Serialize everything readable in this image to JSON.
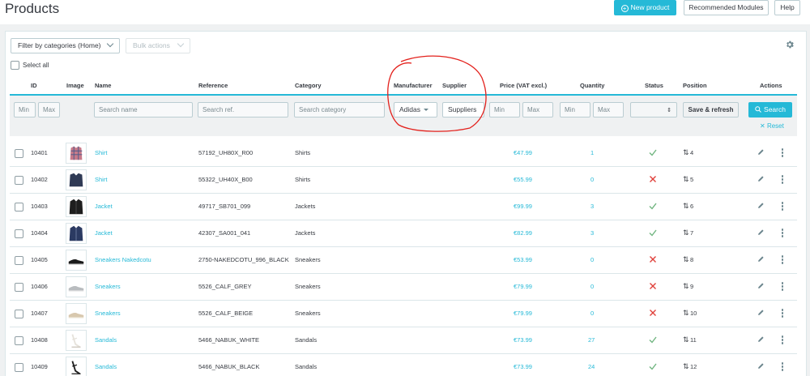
{
  "header": {
    "title": "Products",
    "new_product": "New product",
    "recommended": "Recommended Modules",
    "help": "Help"
  },
  "toolbar": {
    "filter_categories": "Filter by categories (Home)",
    "bulk_actions": "Bulk actions",
    "select_all": "Select all"
  },
  "columns": {
    "id": "ID",
    "image": "Image",
    "name": "Name",
    "reference": "Reference",
    "category": "Category",
    "manufacturer": "Manufacturer",
    "supplier": "Supplier",
    "price": "Price (VAT excl.)",
    "quantity": "Quantity",
    "status": "Status",
    "position": "Position",
    "actions": "Actions"
  },
  "filters": {
    "id_min": "Min",
    "id_max": "Max",
    "name_placeholder": "Search name",
    "ref_placeholder": "Search ref.",
    "category_placeholder": "Search category",
    "manufacturer_value": "Adidas",
    "supplier_value": "Suppliers",
    "price_min": "Min",
    "price_max": "Max",
    "qty_min": "Min",
    "qty_max": "Max",
    "save_refresh": "Save & refresh",
    "search": "Search",
    "reset": "Reset"
  },
  "colors": {
    "accent": "#25b9d7",
    "success": "#70b580",
    "danger": "#e0403a",
    "annotation": "#e3211c"
  },
  "rows": [
    {
      "id": "10401",
      "name": "Shirt",
      "ref": "57192_UH80X_R00",
      "category": "Shirts",
      "price": "€47.99",
      "qty": "1",
      "status": true,
      "position": "4",
      "thumb": "shirt-plaid"
    },
    {
      "id": "10402",
      "name": "Shirt",
      "ref": "55322_UH40X_B00",
      "category": "Shirts",
      "price": "€55.99",
      "qty": "0",
      "status": false,
      "position": "5",
      "thumb": "shirt-navy"
    },
    {
      "id": "10403",
      "name": "Jacket",
      "ref": "49717_SB701_099",
      "category": "Jackets",
      "price": "€99.99",
      "qty": "3",
      "status": true,
      "position": "6",
      "thumb": "jacket-black"
    },
    {
      "id": "10404",
      "name": "Jacket",
      "ref": "42307_SA001_041",
      "category": "Jackets",
      "price": "€82.99",
      "qty": "3",
      "status": true,
      "position": "7",
      "thumb": "jacket-navy"
    },
    {
      "id": "10405",
      "name": "Sneakers Nakedcotu",
      "ref": "2750-NAKEDCOTU_996_BLACK",
      "category": "Sneakers",
      "price": "€53.99",
      "qty": "0",
      "status": false,
      "position": "8",
      "thumb": "sneaker-black"
    },
    {
      "id": "10406",
      "name": "Sneakers",
      "ref": "5526_CALF_GREY",
      "category": "Sneakers",
      "price": "€79.99",
      "qty": "0",
      "status": false,
      "position": "9",
      "thumb": "sneaker-grey"
    },
    {
      "id": "10407",
      "name": "Sneakers",
      "ref": "5526_CALF_BEIGE",
      "category": "Sneakers",
      "price": "€79.99",
      "qty": "0",
      "status": false,
      "position": "10",
      "thumb": "sneaker-beige"
    },
    {
      "id": "10408",
      "name": "Sandals",
      "ref": "5466_NABUK_WHITE",
      "category": "Sandals",
      "price": "€73.99",
      "qty": "27",
      "status": true,
      "position": "11",
      "thumb": "sandal-white"
    },
    {
      "id": "10409",
      "name": "Sandals",
      "ref": "5466_NABUK_BLACK",
      "category": "Sandals",
      "price": "€73.99",
      "qty": "24",
      "status": true,
      "position": "12",
      "thumb": "sandal-black"
    }
  ]
}
